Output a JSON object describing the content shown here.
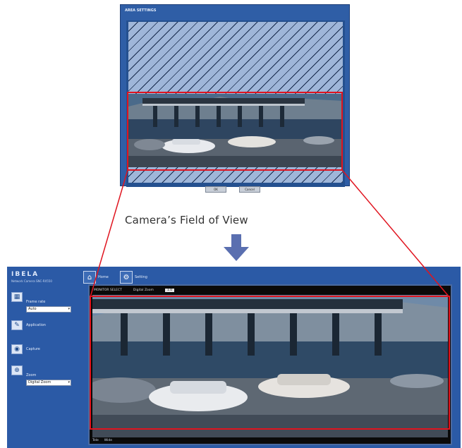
{
  "caption": "Camera’s Field of View",
  "colors": {
    "window_blue": "#2f5ea6",
    "highlight_red": "#e0141f",
    "arrow": "#5a6fb0"
  },
  "top_window": {
    "title": "AREA SETTINGS",
    "buttons": [
      "OK",
      "Cancel"
    ]
  },
  "app": {
    "logo": "IBELA",
    "logo_subtitle": "Network Camera SNC-RX550",
    "toolbar": [
      {
        "label": "Home",
        "icon": "home-icon"
      },
      {
        "label": "Setting",
        "icon": "setting-icon"
      }
    ],
    "sidebar": [
      {
        "label": "Frame rate",
        "select": "Auto",
        "icon": "frame-rate-icon"
      },
      {
        "label": "Application",
        "icon": "application-icon"
      },
      {
        "label": "Capture",
        "icon": "capture-icon"
      },
      {
        "label": "Zoom",
        "select": "Digital Zoom",
        "icon": "zoom-icon"
      }
    ],
    "viewer_bar": [
      "MONITOR SELECT",
      "Digital Zoom",
      "1.0"
    ],
    "viewer_status": [
      "Tele",
      "Wide"
    ]
  },
  "icons": {
    "down_arrow": "arrow-down-icon"
  }
}
